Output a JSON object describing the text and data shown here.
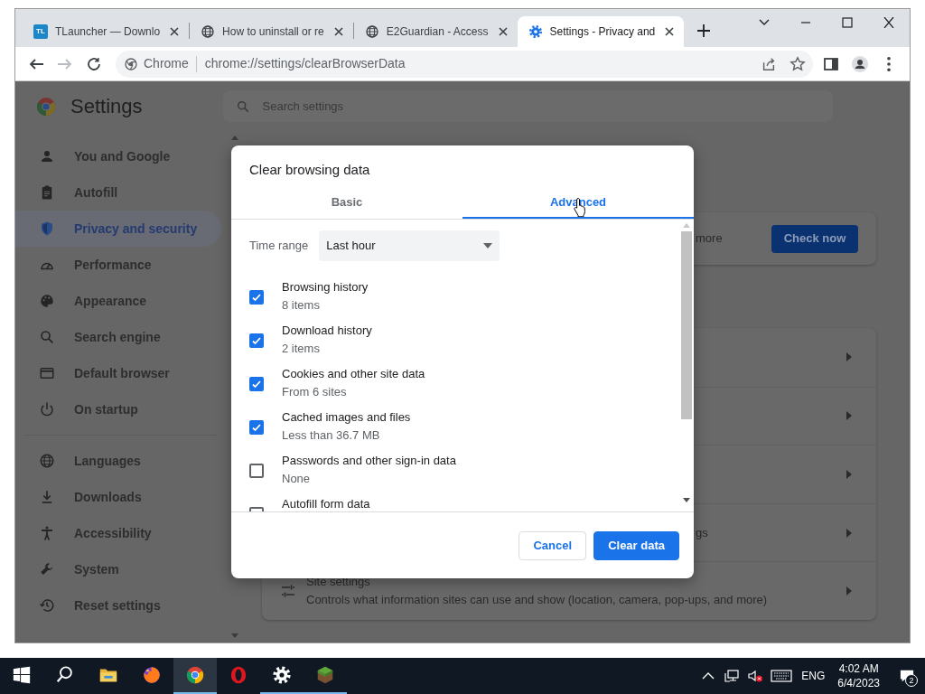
{
  "browser": {
    "tabs": [
      {
        "title": "TLauncher — Downlo",
        "kind": "monogram",
        "icon_text": "TL",
        "selected": false
      },
      {
        "title": "How to uninstall or re",
        "kind": "globe",
        "selected": false
      },
      {
        "title": "E2Guardian - Access",
        "kind": "globe",
        "selected": false
      },
      {
        "title": "Settings - Privacy and",
        "kind": "gear",
        "selected": true
      }
    ],
    "nav_buttons": [
      {
        "kind": "back",
        "disabled": false
      },
      {
        "kind": "forward",
        "disabled": true
      },
      {
        "kind": "reload",
        "disabled": false
      }
    ],
    "chip": "Chrome",
    "url": "chrome://settings/clearBrowserData"
  },
  "settings": {
    "title": "Settings",
    "search_placeholder": "Search settings",
    "sidebar": [
      [
        {
          "label": "You and Google",
          "kind": "person",
          "selected": false
        },
        {
          "label": "Autofill",
          "kind": "clipboard",
          "selected": false
        },
        {
          "label": "Privacy and security",
          "kind": "shield",
          "selected": true
        },
        {
          "label": "Performance",
          "kind": "gauge",
          "selected": false
        },
        {
          "label": "Appearance",
          "kind": "palette",
          "selected": false
        },
        {
          "label": "Search engine",
          "kind": "search",
          "selected": false
        },
        {
          "label": "Default browser",
          "kind": "window",
          "selected": false
        },
        {
          "label": "On startup",
          "kind": "power",
          "selected": false
        }
      ],
      [
        {
          "label": "Languages",
          "kind": "globe",
          "selected": false
        },
        {
          "label": "Downloads",
          "kind": "download",
          "selected": false
        },
        {
          "label": "Accessibility",
          "kind": "figure",
          "selected": false
        },
        {
          "label": "System",
          "kind": "wrench",
          "selected": false
        },
        {
          "label": "Reset settings",
          "kind": "history",
          "selected": false
        }
      ]
    ],
    "safety_fragment": "more",
    "check_button": "Check now",
    "rows": [
      {
        "kind": "covered"
      },
      {
        "kind": "covered"
      },
      {
        "kind": "covered"
      },
      {
        "kind": "fragment",
        "text": "gs"
      },
      {
        "kind": "site",
        "title": "Site settings",
        "description": "Controls what information sites can use and show (location, camera, pop-ups, and more)"
      }
    ]
  },
  "dialog": {
    "title": "Clear browsing data",
    "tabs": [
      {
        "label": "Basic",
        "selected": false
      },
      {
        "label": "Advanced",
        "selected": true
      }
    ],
    "time_range": {
      "label": "Time range",
      "value": "Last hour"
    },
    "options": [
      {
        "label": "Browsing history",
        "detail": "8 items",
        "checked": true
      },
      {
        "label": "Download history",
        "detail": "2 items",
        "checked": true
      },
      {
        "label": "Cookies and other site data",
        "detail": "From 6 sites",
        "checked": true
      },
      {
        "label": "Cached images and files",
        "detail": "Less than 36.7 MB",
        "checked": true
      },
      {
        "label": "Passwords and other sign-in data",
        "detail": "None",
        "checked": false
      },
      {
        "label": "Autofill form data",
        "checked": false
      }
    ],
    "buttons": [
      {
        "label": "Cancel",
        "kind": "secondary"
      },
      {
        "label": "Clear data",
        "kind": "primary"
      }
    ]
  },
  "taskbar": {
    "apps": [
      {
        "kind": "start",
        "running": false,
        "selected": false
      },
      {
        "kind": "search",
        "running": false,
        "selected": false
      },
      {
        "kind": "folder",
        "running": false,
        "selected": false
      },
      {
        "kind": "firefox",
        "running": false,
        "selected": false
      },
      {
        "kind": "chrome",
        "running": true,
        "selected": true
      },
      {
        "kind": "opera",
        "running": false,
        "selected": false
      },
      {
        "kind": "gear",
        "running": true,
        "selected": false
      },
      {
        "kind": "block",
        "running": true,
        "selected": false
      }
    ],
    "language": "ENG",
    "time": "4:02 AM",
    "date": "6/4/2023",
    "notification_count": "2"
  }
}
